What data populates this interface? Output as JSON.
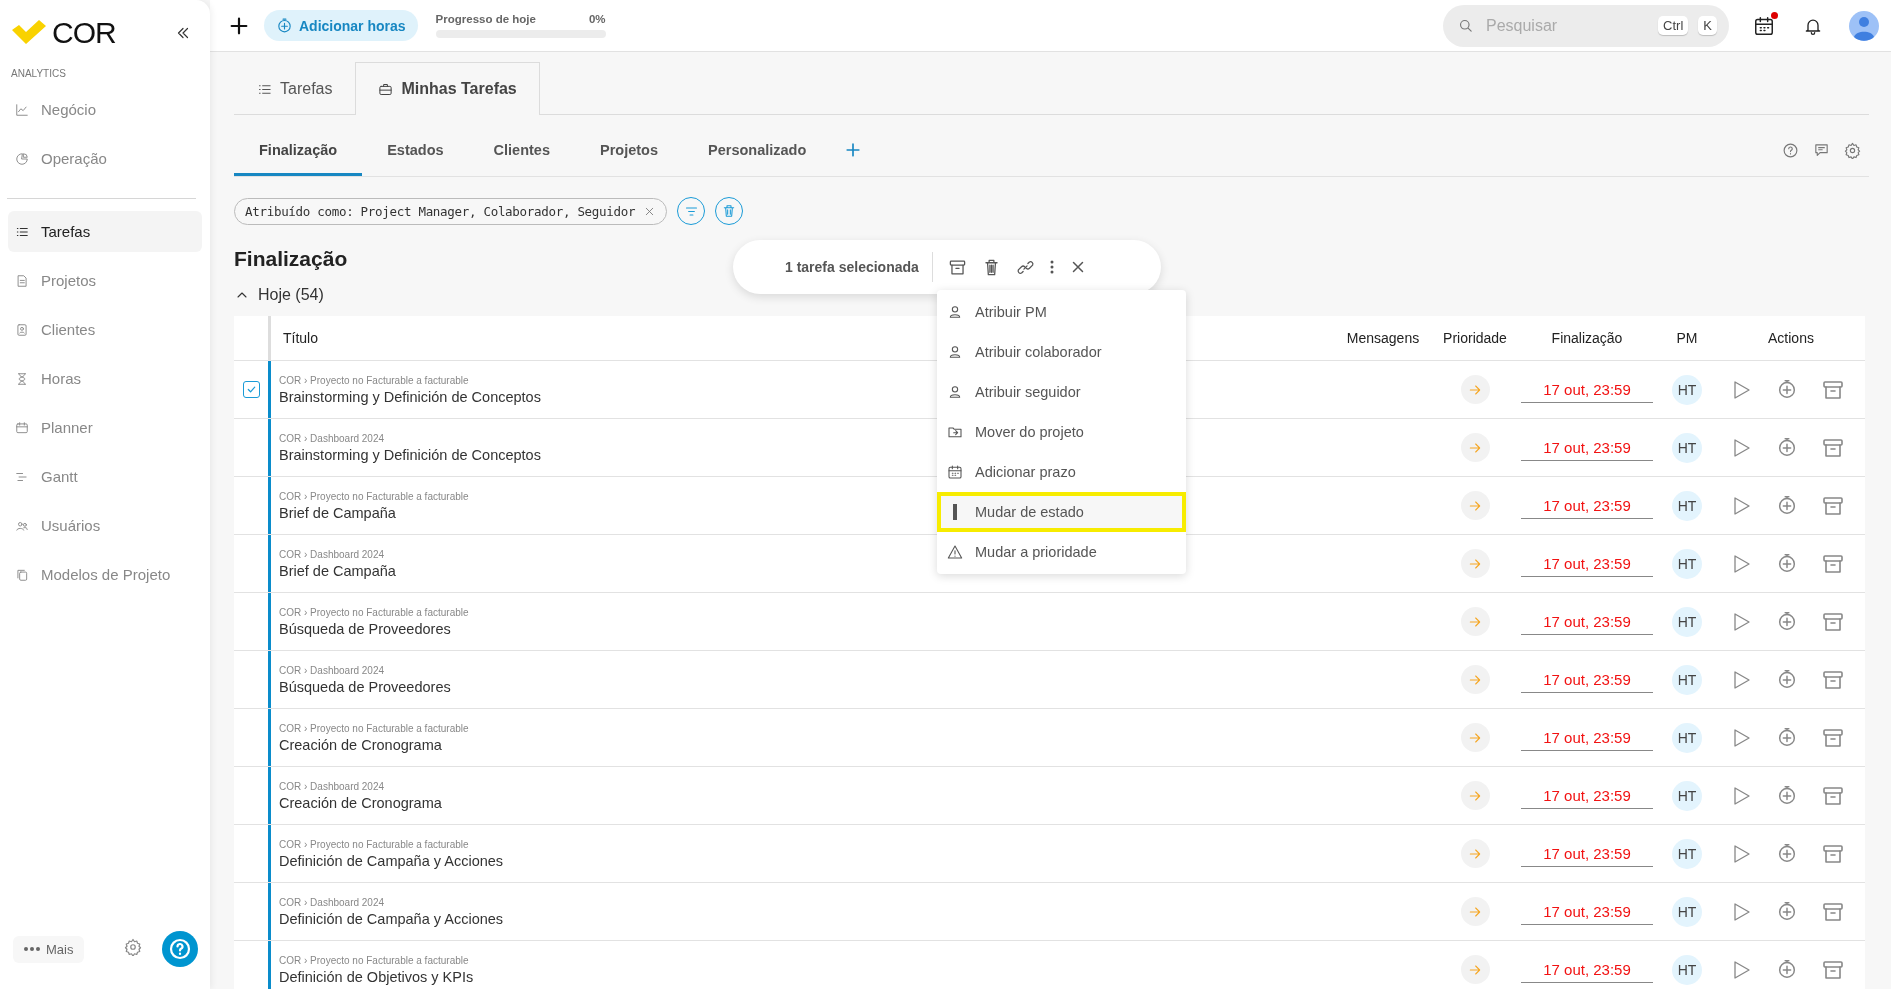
{
  "sidebar": {
    "logo": "COR",
    "section": "ANALYTICS",
    "analytics": [
      {
        "label": "Negócio"
      },
      {
        "label": "Operação"
      }
    ],
    "items": [
      {
        "label": "Tarefas",
        "selected": true
      },
      {
        "label": "Projetos",
        "selected": false
      },
      {
        "label": "Clientes",
        "selected": false
      },
      {
        "label": "Horas",
        "selected": false
      },
      {
        "label": "Planner",
        "selected": false
      },
      {
        "label": "Gantt",
        "selected": false
      },
      {
        "label": "Usuários",
        "selected": false
      },
      {
        "label": "Modelos de Projeto",
        "selected": false
      }
    ],
    "more": "Mais"
  },
  "topbar": {
    "add_hours": "Adicionar horas",
    "progress": {
      "label": "Progresso de hoje",
      "reading": "0%",
      "level": 0
    },
    "search": {
      "placeholder": "Pesquisar",
      "keys": [
        "Ctrl",
        "K"
      ]
    },
    "calendar_alert": true
  },
  "tabs": [
    {
      "label": "Tarefas",
      "selected": false
    },
    {
      "label": "Minhas Tarefas",
      "selected": true
    }
  ],
  "view_tabs": [
    {
      "label": "Finalização",
      "selected": true
    },
    {
      "label": "Estados",
      "selected": false
    },
    {
      "label": "Clientes",
      "selected": false
    },
    {
      "label": "Projetos",
      "selected": false
    },
    {
      "label": "Personalizado",
      "selected": false
    }
  ],
  "filter": {
    "chip": "Atribuído como: Project Manager, Colaborador, Seguidor"
  },
  "heading": "Finalização",
  "group": {
    "label": "Hoje (54)",
    "expanded": true
  },
  "table": {
    "columns": [
      "Título",
      "Mensagens",
      "Prioridade",
      "Finalização",
      "PM",
      "Actions"
    ],
    "rows": [
      {
        "path": "COR › Proyecto no Facturable a facturable",
        "title": "Brainstorming y Definición de Conceptos",
        "checked": true,
        "due": "17 out, 23:59",
        "pm": "HT"
      },
      {
        "path": "COR › Dashboard 2024",
        "title": "Brainstorming y Definición de Conceptos",
        "checked": false,
        "due": "17 out, 23:59",
        "pm": "HT"
      },
      {
        "path": "COR › Proyecto no Facturable a facturable",
        "title": "Brief de Campaña",
        "checked": false,
        "due": "17 out, 23:59",
        "pm": "HT"
      },
      {
        "path": "COR › Dashboard 2024",
        "title": "Brief de Campaña",
        "checked": false,
        "due": "17 out, 23:59",
        "pm": "HT"
      },
      {
        "path": "COR › Proyecto no Facturable a facturable",
        "title": "Búsqueda de Proveedores",
        "checked": false,
        "due": "17 out, 23:59",
        "pm": "HT"
      },
      {
        "path": "COR › Dashboard 2024",
        "title": "Búsqueda de Proveedores",
        "checked": false,
        "due": "17 out, 23:59",
        "pm": "HT"
      },
      {
        "path": "COR › Proyecto no Facturable a facturable",
        "title": "Creación de Cronograma",
        "checked": false,
        "due": "17 out, 23:59",
        "pm": "HT"
      },
      {
        "path": "COR › Dashboard 2024",
        "title": "Creación de Cronograma",
        "checked": false,
        "due": "17 out, 23:59",
        "pm": "HT"
      },
      {
        "path": "COR › Proyecto no Facturable a facturable",
        "title": "Definición de Campaña y Acciones",
        "checked": false,
        "due": "17 out, 23:59",
        "pm": "HT"
      },
      {
        "path": "COR › Dashboard 2024",
        "title": "Definición de Campaña y Acciones",
        "checked": false,
        "due": "17 out, 23:59",
        "pm": "HT"
      },
      {
        "path": "COR › Proyecto no Facturable a facturable",
        "title": "Definición de Objetivos y KPIs",
        "checked": false,
        "due": "17 out, 23:59",
        "pm": "HT"
      }
    ]
  },
  "selection_bar": {
    "label": "1 tarefa selecionada"
  },
  "menu": [
    {
      "label": "Atribuir PM",
      "kind": "person",
      "highlighted": false
    },
    {
      "label": "Atribuir colaborador",
      "kind": "person",
      "highlighted": false
    },
    {
      "label": "Atribuir seguidor",
      "kind": "person",
      "highlighted": false
    },
    {
      "label": "Mover do projeto",
      "kind": "folder",
      "highlighted": false
    },
    {
      "label": "Adicionar prazo",
      "kind": "calendar",
      "highlighted": false
    },
    {
      "label": "Mudar de estado",
      "kind": "state",
      "highlighted": true
    },
    {
      "label": "Mudar a prioridade",
      "kind": "warning",
      "highlighted": false
    }
  ]
}
